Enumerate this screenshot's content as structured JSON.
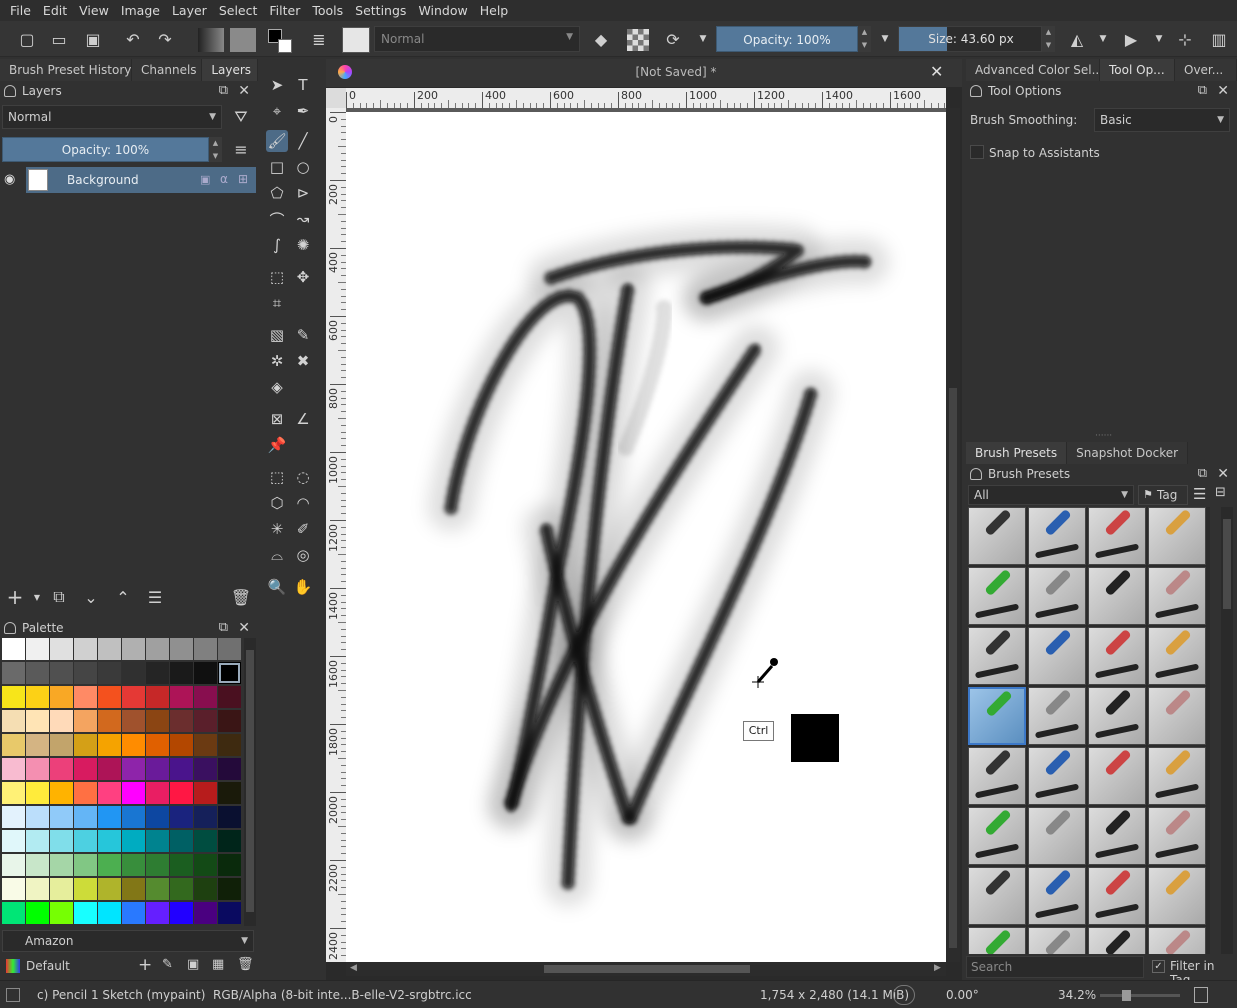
{
  "menu": [
    "File",
    "Edit",
    "View",
    "Image",
    "Layer",
    "Select",
    "Filter",
    "Tools",
    "Settings",
    "Window",
    "Help"
  ],
  "toolbar": {
    "blend_mode": "Normal",
    "opacity": "Opacity: 100%",
    "size": "Size: 43.60 px"
  },
  "left_tabs": [
    "Brush Preset History",
    "Channels",
    "Layers"
  ],
  "layers": {
    "title": "Layers",
    "blend_mode": "Normal",
    "opacity": "Opacity:  100%",
    "layer_name": "Background"
  },
  "palette": {
    "title": "Palette",
    "name": "Amazon",
    "preset": "Default",
    "rows": [
      [
        "#ffffff",
        "#f0f0f0",
        "#e0e0e0",
        "#d0d0d0",
        "#c0c0c0",
        "#b0b0b0",
        "#a0a0a0",
        "#909090",
        "#808080",
        "#707070"
      ],
      [
        "#6a6a6a",
        "#5a5a5a",
        "#505050",
        "#454545",
        "#3a3a3a",
        "#303030",
        "#252525",
        "#1a1a1a",
        "#101010",
        "#000000"
      ],
      [
        "#f7e51a",
        "#fcd116",
        "#f9a825",
        "#ff8a65",
        "#f4511e",
        "#e53935",
        "#c62828",
        "#ad1457",
        "#880e4f",
        "#4a1020"
      ],
      [
        "#f5deb3",
        "#ffe4b5",
        "#ffdab9",
        "#f4a460",
        "#d2691e",
        "#a0522d",
        "#8b4513",
        "#6b2e2e",
        "#5a1f2b",
        "#3a1515"
      ],
      [
        "#e8c96a",
        "#d4b483",
        "#c2a46b",
        "#d4a017",
        "#f5a300",
        "#ff8c00",
        "#e06000",
        "#b34700",
        "#6b3a12",
        "#3e2a10"
      ],
      [
        "#f8bbd0",
        "#f48fb1",
        "#ec407a",
        "#d81b60",
        "#ad1457",
        "#8e24aa",
        "#6a1b9a",
        "#4a148c",
        "#3a1060",
        "#240a3a"
      ],
      [
        "#fff176",
        "#ffeb3b",
        "#ffb300",
        "#ff7043",
        "#ff4081",
        "#ff00ff",
        "#e91e63",
        "#ff1744",
        "#b71c1c",
        "#1a1a0a"
      ],
      [
        "#e3f2fd",
        "#bbdefb",
        "#90caf9",
        "#64b5f6",
        "#2196f3",
        "#1976d2",
        "#0d47a1",
        "#1a237e",
        "#15205a",
        "#0a1030"
      ],
      [
        "#e0f7fa",
        "#b2ebf2",
        "#80deea",
        "#4dd0e1",
        "#26c6da",
        "#00acc1",
        "#00838f",
        "#006064",
        "#004d40",
        "#00251a"
      ],
      [
        "#e8f5e9",
        "#c8e6c9",
        "#a5d6a7",
        "#81c784",
        "#4caf50",
        "#388e3c",
        "#2e7d32",
        "#1b5e20",
        "#134a16",
        "#0a2a0c"
      ],
      [
        "#f9fbe7",
        "#f0f4c3",
        "#e6ee9c",
        "#cddc39",
        "#afb42b",
        "#827717",
        "#558b2f",
        "#33691e",
        "#1e4010",
        "#102008"
      ],
      [
        "#00e676",
        "#00ff00",
        "#76ff03",
        "#18ffff",
        "#00e5ff",
        "#2979ff",
        "#651fff",
        "#2200ff",
        "#4a0080",
        "#0a0a60"
      ]
    ]
  },
  "document": {
    "title": "[Not Saved]  *",
    "h_ruler": [
      "0",
      "200",
      "400",
      "600",
      "800",
      "1000",
      "1200",
      "1400",
      "1600"
    ],
    "v_ruler": [
      "0",
      "200",
      "400",
      "600",
      "800",
      "1000",
      "1200",
      "1400",
      "1600",
      "1800",
      "2000",
      "2200",
      "2400"
    ],
    "tooltip": "Ctrl"
  },
  "right_tabs": [
    "Advanced Color Sel...",
    "Tool Op...",
    "Over..."
  ],
  "tool_options": {
    "title": "Tool Options",
    "smoothing_label": "Brush Smoothing:",
    "smoothing_value": "Basic",
    "snap_label": "Snap to Assistants"
  },
  "brush_tabs": [
    "Brush Presets",
    "Snapshot Docker"
  ],
  "brush_presets": {
    "title": "Brush Presets",
    "filter": "All",
    "tag": "Tag",
    "search_placeholder": "Search",
    "filter_in_tag": "Filter in Tag"
  },
  "status": {
    "brush": "c) Pencil 1 Sketch (mypaint)",
    "color_info": "RGB/Alpha (8-bit inte...B-elle-V2-srgbtrc.icc",
    "dimensions": "1,754 x 2,480 (14.1 MiB)",
    "rotation": "0.00°",
    "zoom": "34.2%"
  }
}
